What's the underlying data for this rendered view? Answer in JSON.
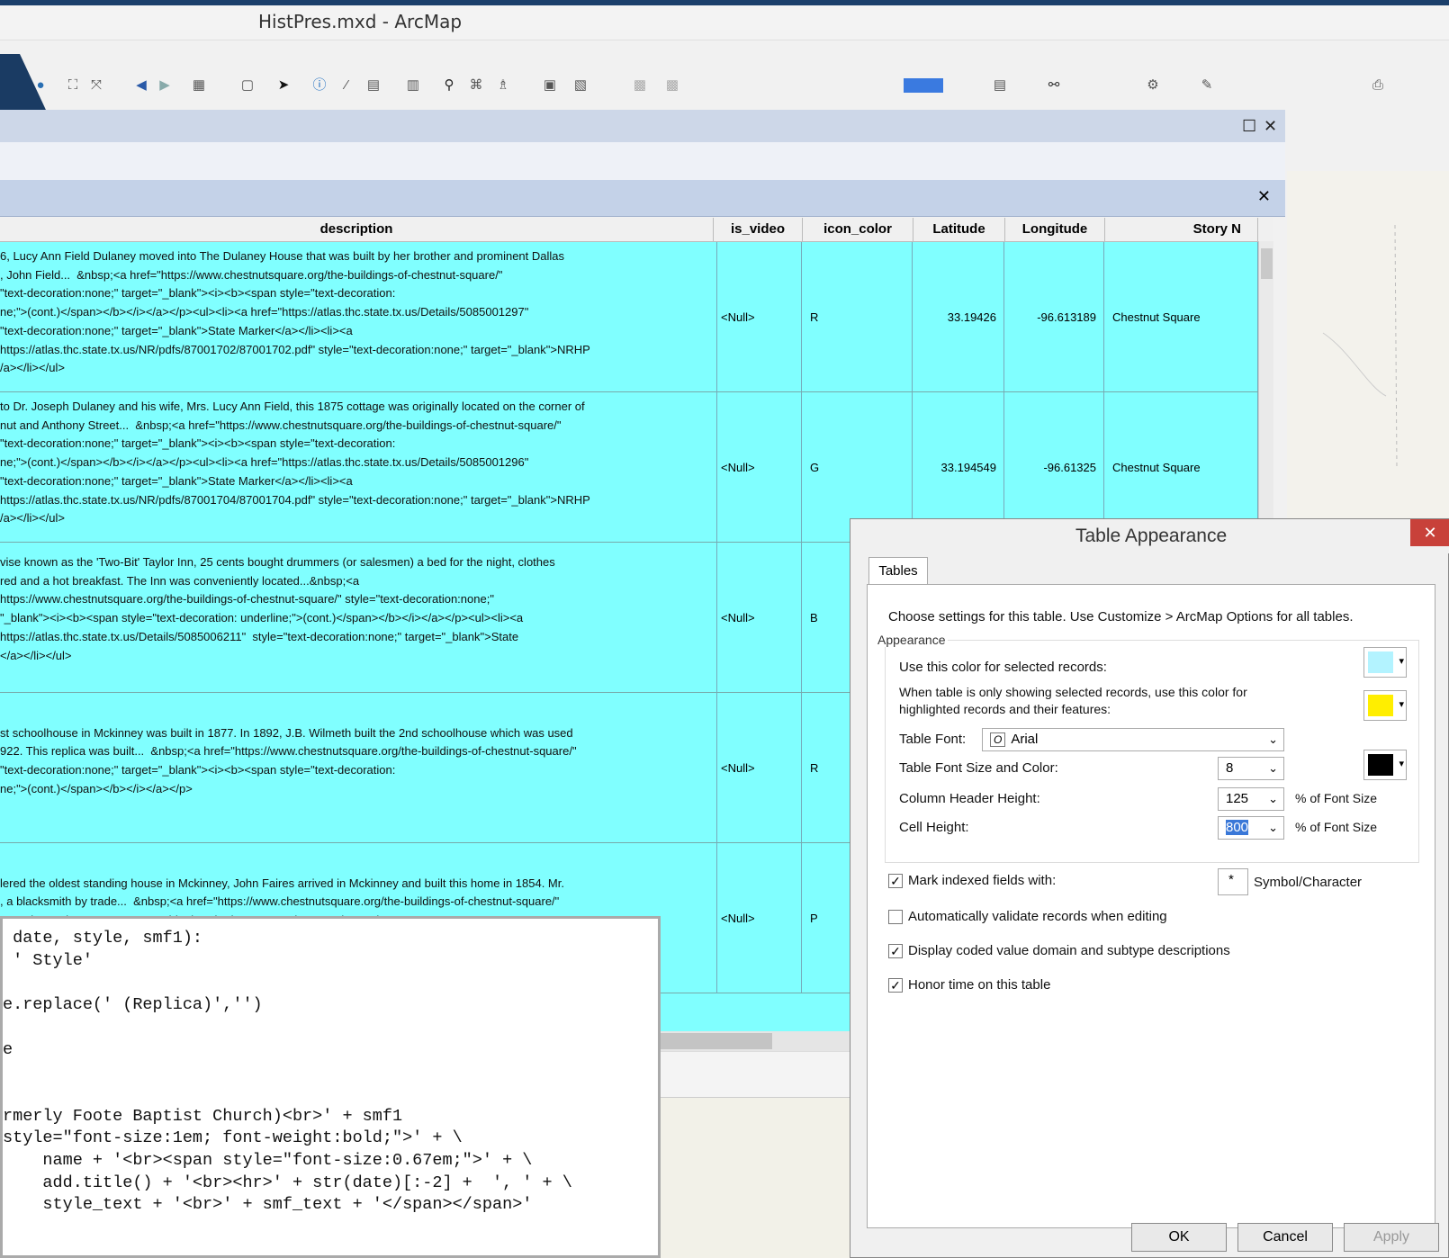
{
  "window": {
    "title": "HistPres.mxd - ArcMap"
  },
  "toolbar": {
    "icons": [
      "globe-icon",
      "full-extent-icon",
      "zoom-fixed-icon",
      "back-arrow-icon",
      "forward-arrow-icon",
      "select-icon",
      "pointer-icon",
      "identify-icon",
      "measure-icon",
      "html-popup-icon",
      "find-icon",
      "route-icon",
      "time-slider-icon",
      "layout-icon"
    ]
  },
  "table": {
    "columns": [
      "description",
      "is_video",
      "icon_color",
      "Latitude",
      "Longitude",
      "Story N"
    ],
    "rows": [
      {
        "description": "6, Lucy Ann Field Dulaney moved into The Dulaney House that was built by her brother and prominent Dallas\n, John Field...  &nbsp;<a href=\"https://www.chestnutsquare.org/the-buildings-of-chestnut-square/\"\n\"text-decoration:none;\" target=\"_blank\"><i><b><span style=\"text-decoration:\nne;\">(cont.)</span></b></i></a></p><ul><li><a href=\"https://atlas.thc.state.tx.us/Details/5085001297\"\n\"text-decoration:none;\" target=\"_blank\">State Marker</a></li><li><a\nhttps://atlas.thc.state.tx.us/NR/pdfs/87001702/87001702.pdf\" style=\"text-decoration:none;\" target=\"_blank\">NRHP\n/a></li></ul>",
        "is_video": "<Null>",
        "icon_color": "R",
        "lat": "33.19426",
        "lon": "-96.613189",
        "story": "Chestnut Square"
      },
      {
        "description": "to Dr. Joseph Dulaney and his wife, Mrs. Lucy Ann Field, this 1875 cottage was originally located on the corner of\nnut and Anthony Street...  &nbsp;<a href=\"https://www.chestnutsquare.org/the-buildings-of-chestnut-square/\"\n\"text-decoration:none;\" target=\"_blank\"><i><b><span style=\"text-decoration:\nne;\">(cont.)</span></b></i></a></p><ul><li><a href=\"https://atlas.thc.state.tx.us/Details/5085001296\"\n\"text-decoration:none;\" target=\"_blank\">State Marker</a></li><li><a\nhttps://atlas.thc.state.tx.us/NR/pdfs/87001704/87001704.pdf\" style=\"text-decoration:none;\" target=\"_blank\">NRHP\n/a></li></ul>",
        "is_video": "<Null>",
        "icon_color": "G",
        "lat": "33.194549",
        "lon": "-96.61325",
        "story": "Chestnut Square"
      },
      {
        "description": "vise known as the 'Two-Bit' Taylor Inn, 25 cents bought drummers (or salesmen) a bed for the night, clothes\nred and a hot breakfast. The Inn was conveniently located...&nbsp;<a\nhttps://www.chestnutsquare.org/the-buildings-of-chestnut-square/\" style=\"text-decoration:none;\"\n\"_blank\"><i><b><span style=\"text-decoration: underline;\">(cont.)</span></b></i></a></p><ul><li><a\nhttps://atlas.thc.state.tx.us/Details/5085006211\"  style=\"text-decoration:none;\" target=\"_blank\">State\n</a></li></ul>",
        "is_video": "<Null>",
        "icon_color": "B",
        "lat": "",
        "lon": "",
        "story": ""
      },
      {
        "description": "\nst schoolhouse in Mckinney was built in 1877. In 1892, J.B. Wilmeth built the 2nd schoolhouse which was used\n922. This replica was built...  &nbsp;<a href=\"https://www.chestnutsquare.org/the-buildings-of-chestnut-square/\"\n\"text-decoration:none;\" target=\"_blank\"><i><b><span style=\"text-decoration:\nne;\">(cont.)</span></b></i></a></p>",
        "is_video": "<Null>",
        "icon_color": "R",
        "lat": "",
        "lon": "",
        "story": ""
      },
      {
        "description": "\nlered the oldest standing house in Mckinney, John Faires arrived in Mckinney and built this home in 1854. Mr.\n, a blacksmith by trade...  &nbsp;<a href=\"https://www.chestnutsquare.org/the-buildings-of-chestnut-square/\"\n\"text-decoration:none;\" target=\"_blank\"><i><b><span style=\"text-decoration:",
        "is_video": "<Null>",
        "icon_color": "P",
        "lat": "",
        "lon": "",
        "story": ""
      }
    ]
  },
  "code": " date, style, smf1):\n ' Style'\n\ne.replace(' (Replica)','')\n\ne\n\n\nrmerly Foote Baptist Church)<br>' + smf1\nstyle=\"font-size:1em; font-weight:bold;\">' + \\\n    name + '<br><span style=\"font-size:0.67em;\">' + \\\n    add.title() + '<br><hr>' + str(date)[:-2] +  ', ' + \\\n    style_text + '<br>' + smf_text + '</span></span>'",
  "dialog": {
    "title": "Table Appearance",
    "tab": "Tables",
    "intro": "Choose settings for this table. Use Customize > ArcMap Options for all tables.",
    "group": "Appearance",
    "selected_color_label": "Use this color for selected records:",
    "highlight_label_1": "When table is only showing selected records, use this color for",
    "highlight_label_2": "highlighted records and their features:",
    "font_label": "Table Font:",
    "font_value": "Arial",
    "font_size_label": "Table Font Size and Color:",
    "font_size_value": "8",
    "header_height_label": "Column Header Height:",
    "header_height_value": "125",
    "cell_height_label": "Cell Height:",
    "cell_height_value": "800",
    "pct_label": "% of Font Size",
    "mark_indexed": "Mark indexed fields with:",
    "symbol_value": "*",
    "symbol_label": "Symbol/Character",
    "auto_validate": "Automatically validate records when editing",
    "coded_domain": "Display coded value domain and subtype descriptions",
    "honor_time": "Honor time on this table",
    "ok": "OK",
    "cancel": "Cancel",
    "apply": "Apply",
    "colors": {
      "selected": "#b3f3ff",
      "highlight": "#ffee00",
      "font": "#000000"
    }
  }
}
